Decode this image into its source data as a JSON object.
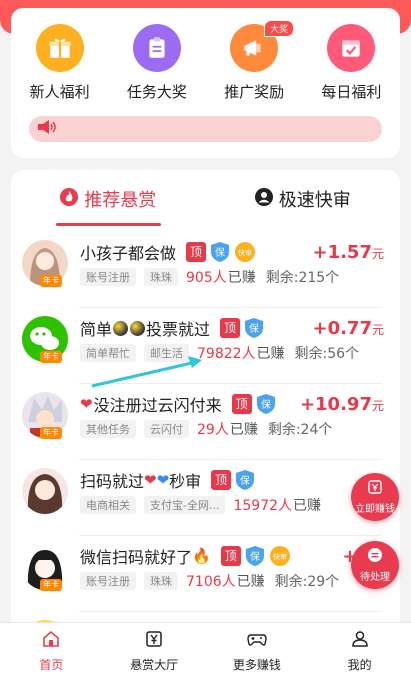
{
  "menu": {
    "items": [
      {
        "label": "新人福利",
        "icon": "gift-icon",
        "color": "#ffb020"
      },
      {
        "label": "任务大奖",
        "icon": "clipboard-icon",
        "color": "#9b6cf2"
      },
      {
        "label": "推广奖励",
        "icon": "megaphone-icon",
        "color": "#ff8a3c",
        "badge": "大奖"
      },
      {
        "label": "每日福利",
        "icon": "calendar-icon",
        "color": "#ff5a7a"
      }
    ]
  },
  "tabs": {
    "recommended": "推荐悬赏",
    "fast_review": "极速快审"
  },
  "badges": {
    "top": "顶",
    "guarantee": "保",
    "fast": "快审",
    "annual": "年卡"
  },
  "tasks": [
    {
      "title": "小孩子都会做",
      "chips": [
        "账号注册",
        "珠珠"
      ],
      "earned": "905人",
      "earned_suffix": "已赚",
      "remaining": "剩余:215个",
      "reward": "+1.57",
      "unit": "元"
    },
    {
      "title_a": "简单",
      "title_b": "投票就过",
      "chips": [
        "简单帮忙",
        "邮生活"
      ],
      "earned": "79822人",
      "earned_suffix": "已赚",
      "remaining": "剩余:56个",
      "reward": "+0.77",
      "unit": "元"
    },
    {
      "title": "没注册过云闪付来",
      "chips": [
        "其他任务",
        "云闪付"
      ],
      "earned": "29人",
      "earned_suffix": "已赚",
      "remaining": "剩余:24个",
      "reward": "+10.97",
      "unit": "元"
    },
    {
      "title_a": "扫码就过",
      "title_b": "秒审",
      "chips": [
        "电商相关",
        "支付宝-全网..."
      ],
      "earned": "15972人",
      "earned_suffix": "已赚",
      "remaining": "",
      "reward": "",
      "unit": ""
    },
    {
      "title": "微信扫码就好了",
      "chips": [
        "账号注册",
        "珠珠"
      ],
      "earned": "7106人",
      "earned_suffix": "已赚",
      "remaining": "剩余:29个",
      "reward": "+1",
      "unit": ""
    }
  ],
  "float_buttons": {
    "earn_now": "立即赚钱",
    "pending": "待处理"
  },
  "tabbar": [
    {
      "label": "首页",
      "icon": "home-icon",
      "active": true
    },
    {
      "label": "悬赏大厅",
      "icon": "yen-icon",
      "active": false
    },
    {
      "label": "更多赚钱",
      "icon": "gamepad-icon",
      "active": false
    },
    {
      "label": "我的",
      "icon": "user-icon",
      "active": false
    }
  ],
  "colors": {
    "accent": "#e83b4f",
    "header": "#ff5a5a"
  }
}
